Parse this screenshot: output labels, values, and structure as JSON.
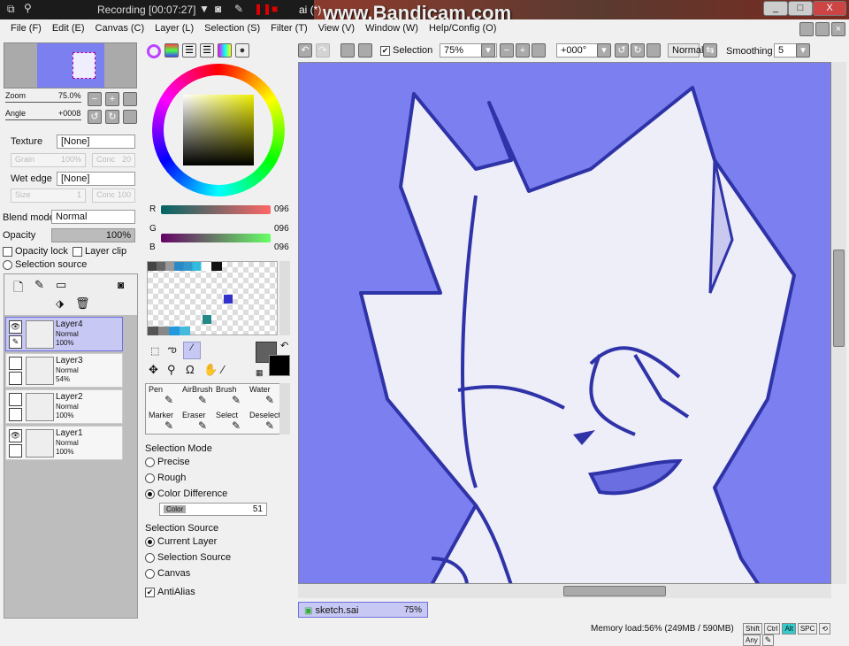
{
  "recorder": {
    "status": "Recording [00:07:27]",
    "title_suffix": "ai (*)",
    "watermark": "www.Bandicam.com"
  },
  "window_buttons": [
    "_",
    "□",
    "X"
  ],
  "menu": [
    "File (F)",
    "Edit (E)",
    "Canvas (C)",
    "Layer (L)",
    "Selection (S)",
    "Filter (T)",
    "View (V)",
    "Window (W)",
    "Help/Config (O)"
  ],
  "toolbar": {
    "selection_label": "Selection",
    "selection_checked": true,
    "zoom": "75%",
    "angle": "+000°",
    "blend": "Normal",
    "smoothing_label": "Smoothing",
    "smoothing": "5"
  },
  "navigator": {
    "zoom_label": "Zoom",
    "zoom_value": "75.0%",
    "angle_label": "Angle",
    "angle_value": "+0008"
  },
  "brush": {
    "texture_label": "Texture",
    "texture": "[None]",
    "grain_label": "Grain",
    "grain": "100%",
    "conc_label": "Conc",
    "conc": "20",
    "wet_label": "Wet edge",
    "wet": "[None]",
    "size_label": "Size",
    "size": "1",
    "conc2": "100"
  },
  "layer_props": {
    "blend_label": "Blend mode",
    "blend": "Normal",
    "opacity_label": "Opacity",
    "opacity": "100%",
    "opacity_lock": "Opacity lock",
    "layer_clip": "Layer clip",
    "selection_source": "Selection source"
  },
  "layers": [
    {
      "name": "Layer4",
      "mode": "Normal",
      "opacity": "100%",
      "visible": true,
      "selected": true
    },
    {
      "name": "Layer3",
      "mode": "Normal",
      "opacity": "54%",
      "visible": false,
      "selected": false
    },
    {
      "name": "Layer2",
      "mode": "Normal",
      "opacity": "100%",
      "visible": false,
      "selected": false
    },
    {
      "name": "Layer1",
      "mode": "Normal",
      "opacity": "100%",
      "visible": true,
      "selected": false
    }
  ],
  "rgb": {
    "r_label": "R",
    "r": "096",
    "g_label": "G",
    "g": "096",
    "b_label": "B",
    "b": "096"
  },
  "tools": [
    "Pen",
    "AirBrush",
    "Brush",
    "Water",
    "Marker",
    "Eraser",
    "Select",
    "Deselect"
  ],
  "selection_mode": {
    "title": "Selection Mode",
    "options": [
      "Precise",
      "Rough",
      "Color Difference"
    ],
    "selected": 2,
    "color_label": "Color",
    "color_value": "51"
  },
  "selection_source": {
    "title": "Selection Source",
    "options": [
      "Current Layer",
      "Selection Source",
      "Canvas"
    ],
    "selected": 0,
    "antialias": "AntiAlias"
  },
  "doc_tab": {
    "name": "sketch.sai",
    "zoom": "75%"
  },
  "status": {
    "memory": "Memory load:56% (249MB / 590MB)",
    "keys": [
      "Shift",
      "Ctrl",
      "Alt",
      "SPC",
      "⟲",
      "Any"
    ]
  },
  "colors": {
    "canvas_bg": "#7b7ff0",
    "line": "#2f33a8",
    "accent": "#c8c8f4"
  }
}
